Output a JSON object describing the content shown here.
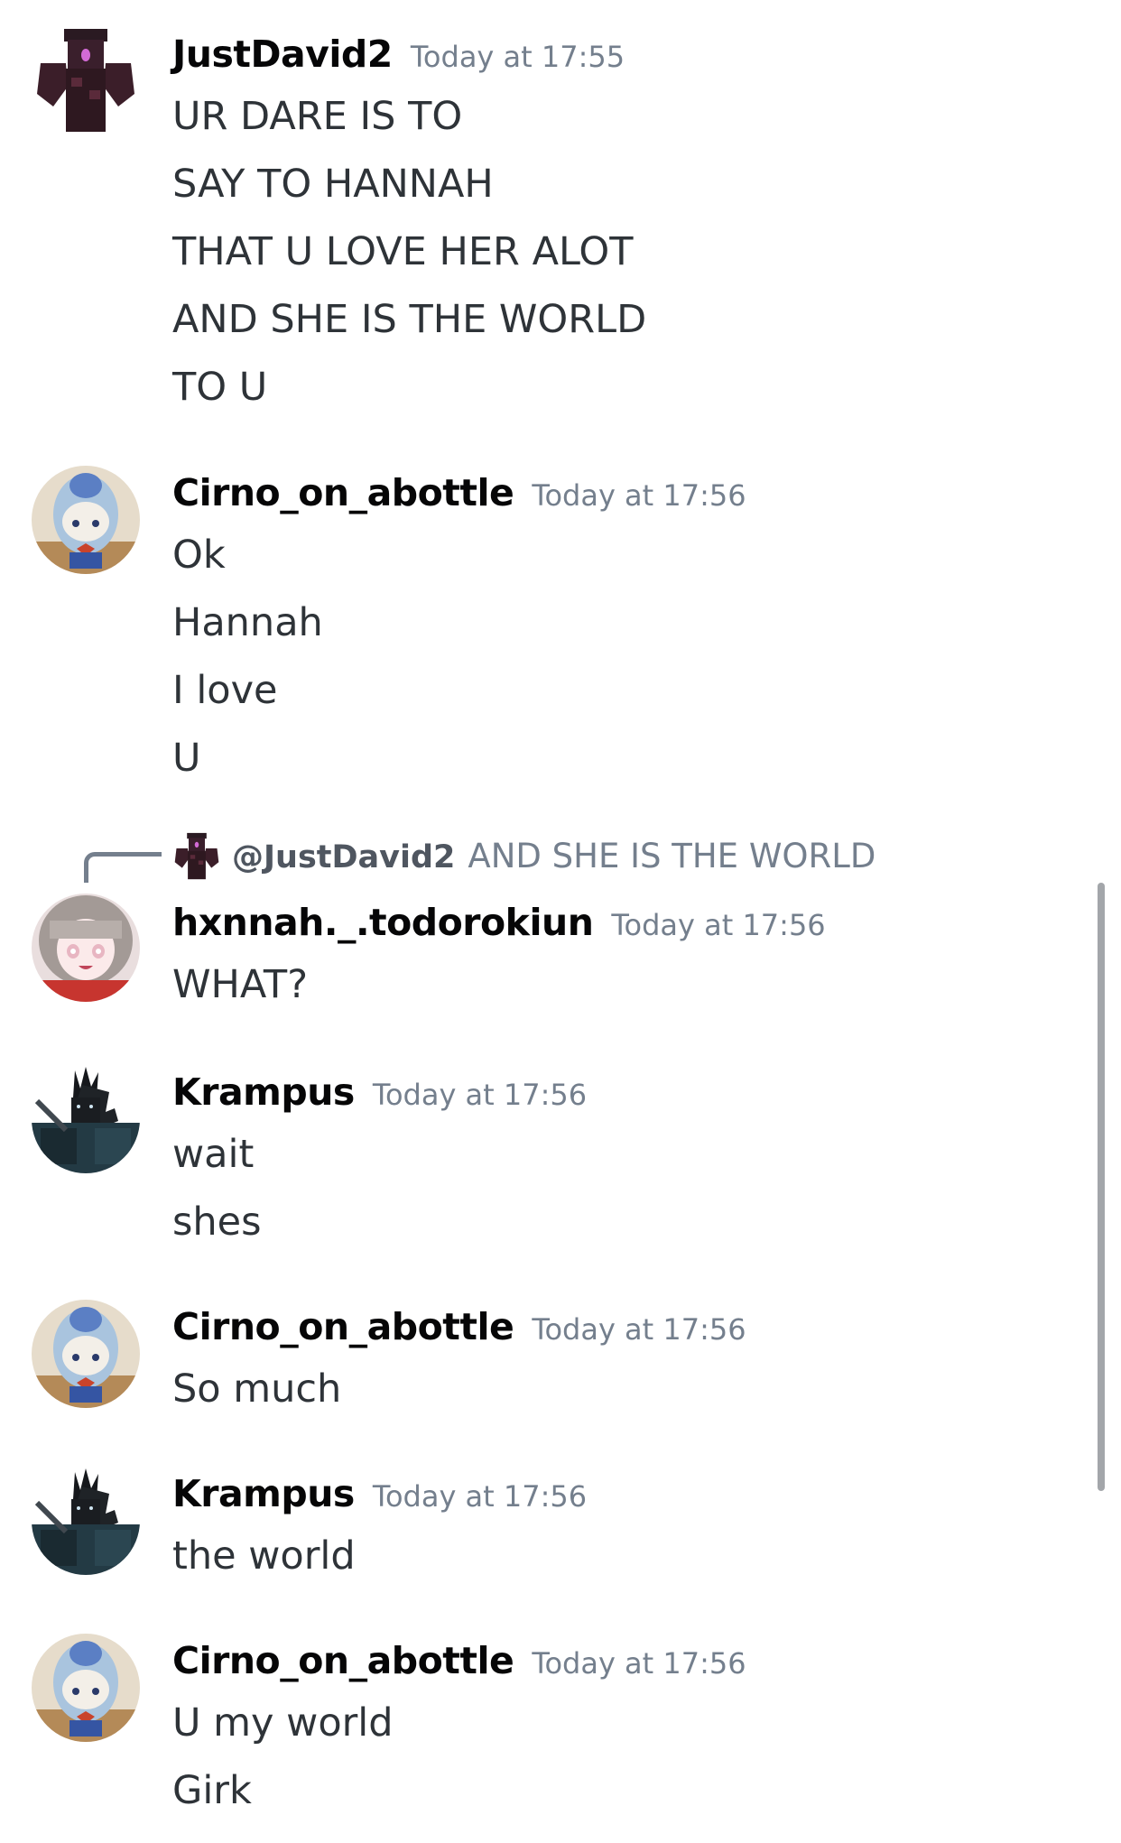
{
  "messages": [
    {
      "author": "JustDavid2",
      "timestamp": "Today at 17:55",
      "lines": [
        "UR DARE IS TO",
        "SAY TO HANNAH",
        "THAT U LOVE HER ALOT",
        "AND SHE IS THE WORLD",
        "TO U"
      ]
    },
    {
      "author": "Cirno_on_abottle",
      "timestamp": "Today at 17:56",
      "lines": [
        "Ok",
        "Hannah",
        "I love",
        "U"
      ]
    },
    {
      "author": "hxnnah._.todorokiun",
      "timestamp": "Today at 17:56",
      "reply": {
        "mention": "@JustDavid2",
        "content": "AND SHE IS THE WORLD"
      },
      "lines": [
        "WHAT?"
      ]
    },
    {
      "author": "Krampus",
      "timestamp": "Today at 17:56",
      "lines": [
        "wait",
        "shes"
      ]
    },
    {
      "author": "Cirno_on_abottle",
      "timestamp": "Today at 17:56",
      "lines": [
        "So much"
      ]
    },
    {
      "author": "Krampus",
      "timestamp": "Today at 17:56",
      "lines": [
        "the world"
      ]
    },
    {
      "author": "Cirno_on_abottle",
      "timestamp": "Today at 17:56",
      "lines": [
        "U my world",
        "Girk"
      ]
    }
  ],
  "colors": {
    "background": "#ffffff",
    "username": "#060607",
    "message_text": "#2e3338",
    "timestamp": "#747f8d",
    "reply_spine": "#747f8d",
    "scrollbar": "#a3a6aa"
  },
  "icons": {
    "justdavid2": "dark-robot-avatar-icon",
    "cirno": "blue-plush-doll-avatar-icon",
    "hxnnah": "anime-girl-avatar-icon",
    "krampus": "dark-spiky-figure-avatar-icon"
  }
}
